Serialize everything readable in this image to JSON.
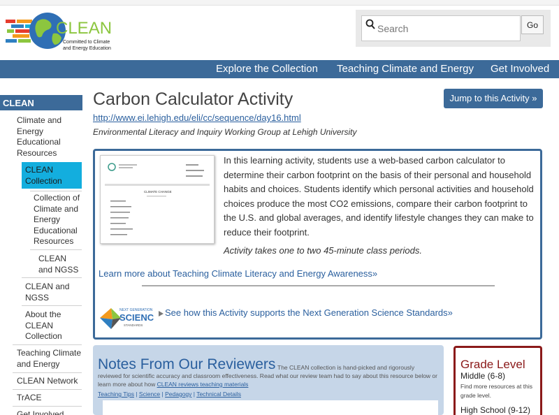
{
  "header": {
    "logo_text": "CLEAN",
    "logo_tagline_1": "Committed to Climate",
    "logo_tagline_2": "and Energy Education",
    "search_placeholder": "Search",
    "go_label": "Go"
  },
  "nav": {
    "items": [
      "Explore the Collection",
      "Teaching Climate and Energy",
      "Get Involved"
    ]
  },
  "sidebar": {
    "heading": "CLEAN",
    "items": [
      {
        "label": "Climate and Energy Educational Resources"
      },
      {
        "label": "CLEAN Collection"
      },
      {
        "label": "Collection of Climate and Energy Educational Resources"
      },
      {
        "label": "CLEAN and NGSS"
      },
      {
        "label": "CLEAN and NGSS"
      },
      {
        "label": "About the CLEAN Collection"
      },
      {
        "label": "Teaching Climate and Energy"
      },
      {
        "label": "CLEAN Network"
      },
      {
        "label": "TrACE"
      },
      {
        "label": "Get Involved"
      }
    ]
  },
  "activity": {
    "title": "Carbon Calculator Activity",
    "url": "http://www.ei.lehigh.edu/eli/cc/sequence/day16.html",
    "organization": "Environmental Literacy and Inquiry Working Group at Lehigh University",
    "jump_label": "Jump to this Activity »",
    "description": "In this learning activity, students use a web-based carbon calculator to determine their carbon footprint on the basis of their personal and household habits and choices. Students identify which personal activities and household choices produce the most CO2 emissions, compare their carbon footprint to the U.S. and global averages, and identify lifestyle changes they can make to reduce their footprint.",
    "duration": "Activity takes one to two 45-minute class periods.",
    "learn_more": "Learn more about Teaching Climate Literacy and Energy Awareness»",
    "ngss_link": "See how this Activity supports the Next Generation Science Standards»",
    "ngss_logo_top": "NEXT GENERATION",
    "ngss_logo_main": "SCIENCE",
    "ngss_logo_bottom": "STANDARDS",
    "thumb_heading": "CLIMATE CHANGE"
  },
  "notes": {
    "title": "Notes From Our Reviewers",
    "text_1": "The CLEAN collection is hand-picked and rigorously reviewed for scientific accuracy and classroom effectiveness. Read what our review team had to say about this resource below or learn more about how ",
    "text_link": "CLEAN reviews teaching materials",
    "links": [
      "Teaching Tips",
      "Science",
      "Pedagogy",
      "Technical Details"
    ]
  },
  "grade": {
    "title": "Grade Level",
    "middle": "Middle (6-8)",
    "note": "Find more resources at this grade level.",
    "high": "High School (9-12)"
  },
  "colors": {
    "nav_blue": "#3c6a99",
    "active_cyan": "#13aede",
    "link_blue": "#2a5f9e",
    "grade_red": "#8b1a1a"
  }
}
